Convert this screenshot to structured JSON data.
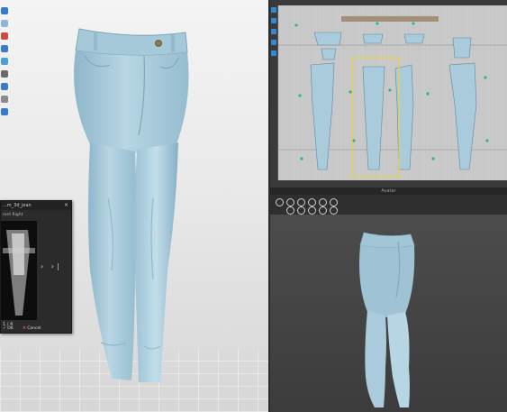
{
  "texture_dialog": {
    "title": "...m_3d_jean",
    "close_glyph": "×",
    "subtitle": "ront Right",
    "nav_next": "›",
    "nav_last": "›|",
    "page_indicator": "1 / 4",
    "ok_label": "OK",
    "cancel_label": "Cancel"
  },
  "avatar_window": {
    "title": "Avatar"
  },
  "colors": {
    "denim": "#a9cbdb",
    "denim_dark": "#7fa7bd",
    "selection_box": "#e9d337",
    "pattern_point": "#2fb3a6"
  }
}
